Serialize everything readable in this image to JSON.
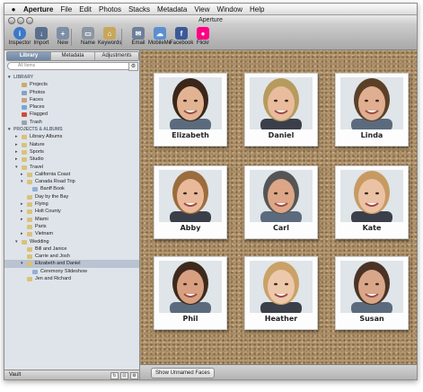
{
  "menubar": {
    "app": "Aperture",
    "items": [
      "File",
      "Edit",
      "Photos",
      "Stacks",
      "Metadata",
      "View",
      "Window",
      "Help"
    ]
  },
  "window": {
    "title": "Aperture"
  },
  "toolbar": {
    "buttons": [
      {
        "label": "Inspector",
        "icon": "info-icon",
        "color": "#3d78c9"
      },
      {
        "label": "Import",
        "icon": "import-icon",
        "color": "#5a6f8c"
      },
      {
        "label": "New",
        "icon": "new-album-icon",
        "color": "#7d8ea6"
      },
      {
        "label": "Name",
        "icon": "name-icon",
        "color": "#8c96a3"
      },
      {
        "label": "Keywords",
        "icon": "keywords-icon",
        "color": "#c9a65a"
      },
      {
        "label": "Email",
        "icon": "email-icon",
        "color": "#6d7f99"
      },
      {
        "label": "MobileMe",
        "icon": "cloud-icon",
        "color": "#5b8fd2"
      },
      {
        "label": "Facebook",
        "icon": "facebook-icon",
        "color": "#3b5998"
      },
      {
        "label": "Flickr",
        "icon": "flickr-icon",
        "color": "#ff0084"
      }
    ]
  },
  "sidebar": {
    "tabs": [
      "Library",
      "Metadata",
      "Adjustments"
    ],
    "search_placeholder": "All Items",
    "library_header": "LIBRARY",
    "library_items": [
      "Projects",
      "Photos",
      "Faces",
      "Places",
      "Flagged",
      "Trash"
    ],
    "projects_header": "PROJECTS & ALBUMS",
    "tree": [
      {
        "label": "Library Albums",
        "level": 1,
        "tw": "▸"
      },
      {
        "label": "Nature",
        "level": 1,
        "tw": "▸"
      },
      {
        "label": "Sports",
        "level": 1,
        "tw": "▸"
      },
      {
        "label": "Studio",
        "level": 1,
        "tw": "▸"
      },
      {
        "label": "Travel",
        "level": 1,
        "tw": "▾"
      },
      {
        "label": "California Coast",
        "level": 2,
        "tw": "▸"
      },
      {
        "label": "Canada Road Trip",
        "level": 2,
        "tw": "▾"
      },
      {
        "label": "Banff Book",
        "level": 3,
        "tw": ""
      },
      {
        "label": "Day by the Bay",
        "level": 2,
        "tw": ""
      },
      {
        "label": "Flying",
        "level": 2,
        "tw": "▸"
      },
      {
        "label": "Holt County",
        "level": 2,
        "tw": "▸"
      },
      {
        "label": "Miami",
        "level": 2,
        "tw": "▸"
      },
      {
        "label": "Paris",
        "level": 2,
        "tw": ""
      },
      {
        "label": "Vietnam",
        "level": 2,
        "tw": "▸"
      },
      {
        "label": "Wedding",
        "level": 1,
        "tw": "▾"
      },
      {
        "label": "Bill and Janice",
        "level": 2,
        "tw": ""
      },
      {
        "label": "Carrie and Josh",
        "level": 2,
        "tw": ""
      },
      {
        "label": "Elizabeth and Daniel",
        "level": 2,
        "tw": "▾",
        "selected": true
      },
      {
        "label": "Ceremony Slideshow",
        "level": 3,
        "tw": ""
      },
      {
        "label": "Jen and Richard",
        "level": 2,
        "tw": ""
      }
    ],
    "vault_label": "Vault"
  },
  "faces": [
    {
      "name": "Elizabeth",
      "skin": "#e2b392",
      "hair": "#3a261a"
    },
    {
      "name": "Daniel",
      "skin": "#e8bc9c",
      "hair": "#b79a5d"
    },
    {
      "name": "Linda",
      "skin": "#e0ae90",
      "hair": "#5b4027"
    },
    {
      "name": "Abby",
      "skin": "#e9b99a",
      "hair": "#9b6c3e"
    },
    {
      "name": "Carl",
      "skin": "#dda687",
      "hair": "#555555"
    },
    {
      "name": "Kate",
      "skin": "#ecc2a4",
      "hair": "#c79a62"
    },
    {
      "name": "Phil",
      "skin": "#d8a080",
      "hair": "#3d2a1c"
    },
    {
      "name": "Heather",
      "skin": "#eec8aa",
      "hair": "#caa167"
    },
    {
      "name": "Susan",
      "skin": "#d9a68a",
      "hair": "#4a3325"
    }
  ],
  "footer": {
    "show_unnamed_label": "Show Unnamed Faces"
  }
}
